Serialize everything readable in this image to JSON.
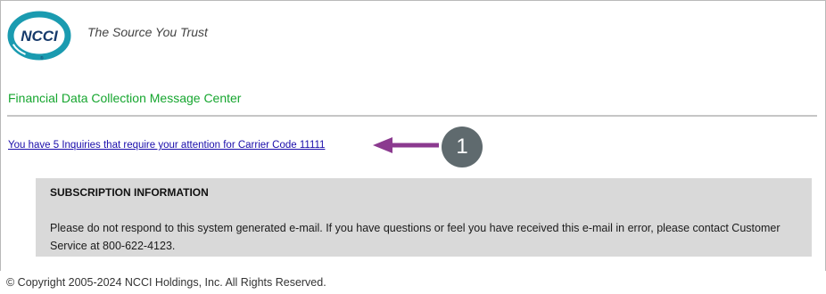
{
  "header": {
    "logo_text": "NCCI",
    "tagline": "The Source You Trust"
  },
  "message_center_title": "Financial Data Collection Message Center",
  "inquiry_link": "You have 5 Inquiries that require your attention for Carrier Code 11111",
  "callout_number": "1",
  "subscription": {
    "title": "SUBSCRIPTION INFORMATION",
    "body": "Please do not respond to this system generated e-mail. If you have questions or feel you have received this e-mail in error, please contact Customer Service at 800-622-4123."
  },
  "copyright": "© Copyright 2005-2024 NCCI Holdings, Inc. All Rights Reserved.",
  "colors": {
    "logo_teal": "#1a9bb0",
    "logo_navy": "#163a6b",
    "green_title": "#16a62f",
    "link_blue": "#1a0dab",
    "arrow_purple": "#8b3a8f",
    "callout_gray": "#5f6a6e",
    "box_gray": "#d9d9d9"
  }
}
